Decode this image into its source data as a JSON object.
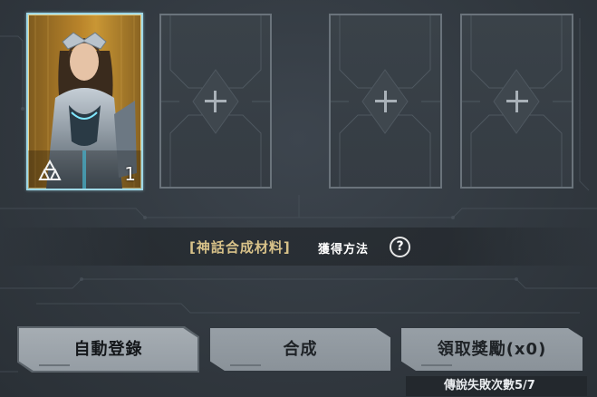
{
  "card_slots": {
    "selected_card": {
      "level": "1",
      "tier_icon": "triforce-tier-icon",
      "frame_color": "#9fd8e6"
    },
    "empty_slot_icon": "plus-icon"
  },
  "materials": {
    "label": "[神話合成材料]",
    "howto": "獲得方法",
    "help_icon": "question-circle-icon"
  },
  "buttons": {
    "auto_register": "自動登錄",
    "synthesize": "合成",
    "claim_reward": "領取獎勵(x0)"
  },
  "status": {
    "fail_count_label": "傳說失敗次數5/7"
  },
  "colors": {
    "accent_gold": "#d8c289",
    "button_gray": "#979fa6",
    "background": "#30363d"
  }
}
